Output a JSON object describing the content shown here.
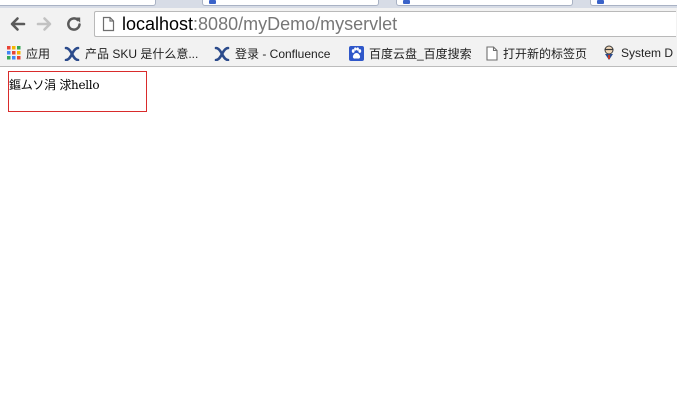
{
  "browser": {
    "address_bar": {
      "host": "localhost",
      "rest": ":8080/myDemo/myservlet"
    },
    "bookmarks": [
      {
        "label": "应用",
        "icon": "apps-grid-icon"
      },
      {
        "label": "产品 SKU 是什么意...",
        "icon": "confluence-x-icon"
      },
      {
        "label": "登录 - Confluence",
        "icon": "confluence-x-icon"
      },
      {
        "label": "百度云盘_百度搜索",
        "icon": "baidu-paw-icon"
      },
      {
        "label": "打开新的标签页",
        "icon": "page-icon"
      },
      {
        "label": "System D",
        "icon": "jenkins-icon"
      }
    ]
  },
  "page": {
    "body_text": "鏂ムソ涓  浗hello"
  }
}
